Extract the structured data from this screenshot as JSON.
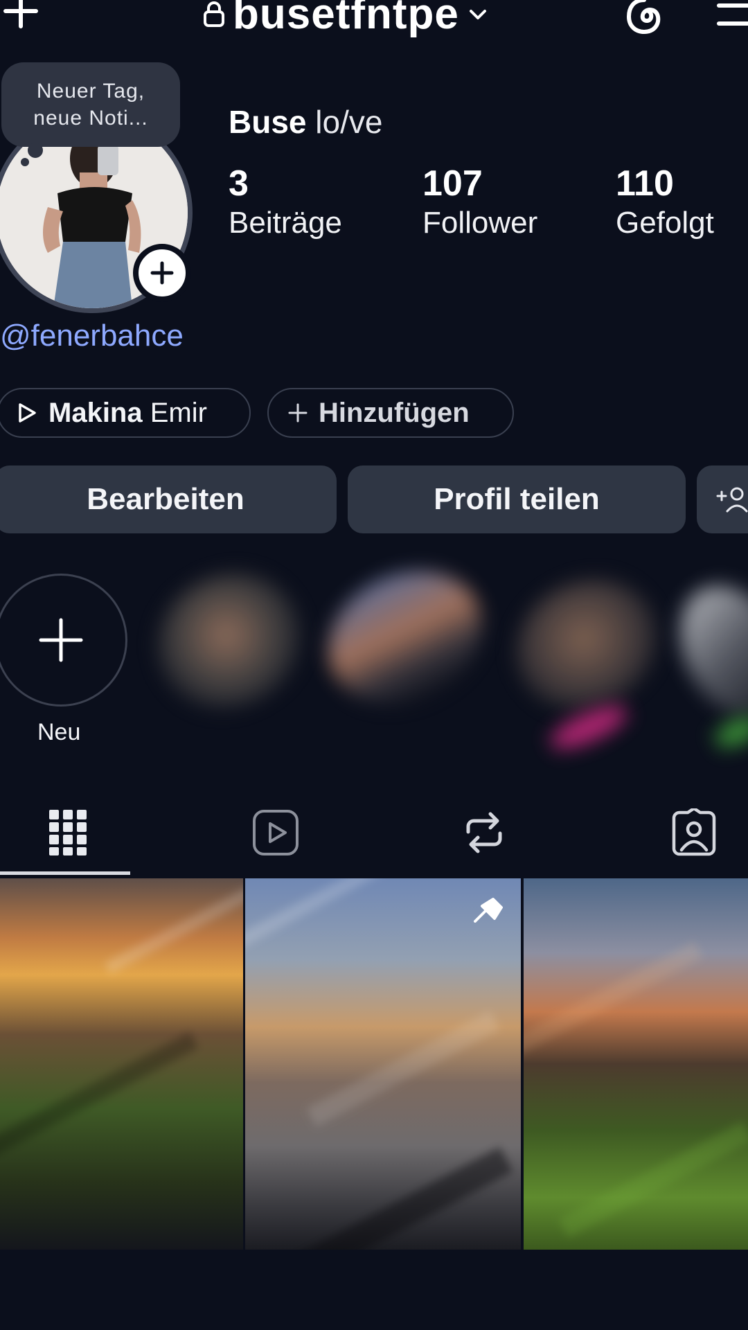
{
  "header": {
    "username": "busetfntpe",
    "icons": [
      "plus-icon",
      "lock-icon",
      "chevron-down-icon",
      "threads-icon",
      "menu-icon"
    ]
  },
  "note": {
    "line1": "Neuer Tag,",
    "line2": "neue Noti..."
  },
  "profile": {
    "name_bold": "Buse",
    "name_rest": "lo/ve",
    "handle_link": "@fenerbahce"
  },
  "stats": [
    {
      "value": "3",
      "label": "Beiträge"
    },
    {
      "value": "107",
      "label": "Follower"
    },
    {
      "value": "110",
      "label": "Gefolgt"
    }
  ],
  "chips": {
    "music_title": "Makina",
    "music_artist": "Emir",
    "add_link": "Hinzufügen"
  },
  "buttons": {
    "edit": "Bearbeiten",
    "share": "Profil teilen"
  },
  "highlights": {
    "new_label": "Neu"
  },
  "tabs": [
    "grid-icon",
    "reels-icon",
    "reposts-icon",
    "tagged-icon"
  ],
  "colors": {
    "background": "#0b0f1c",
    "button": "#2f3644",
    "link": "#8ea9ff"
  }
}
